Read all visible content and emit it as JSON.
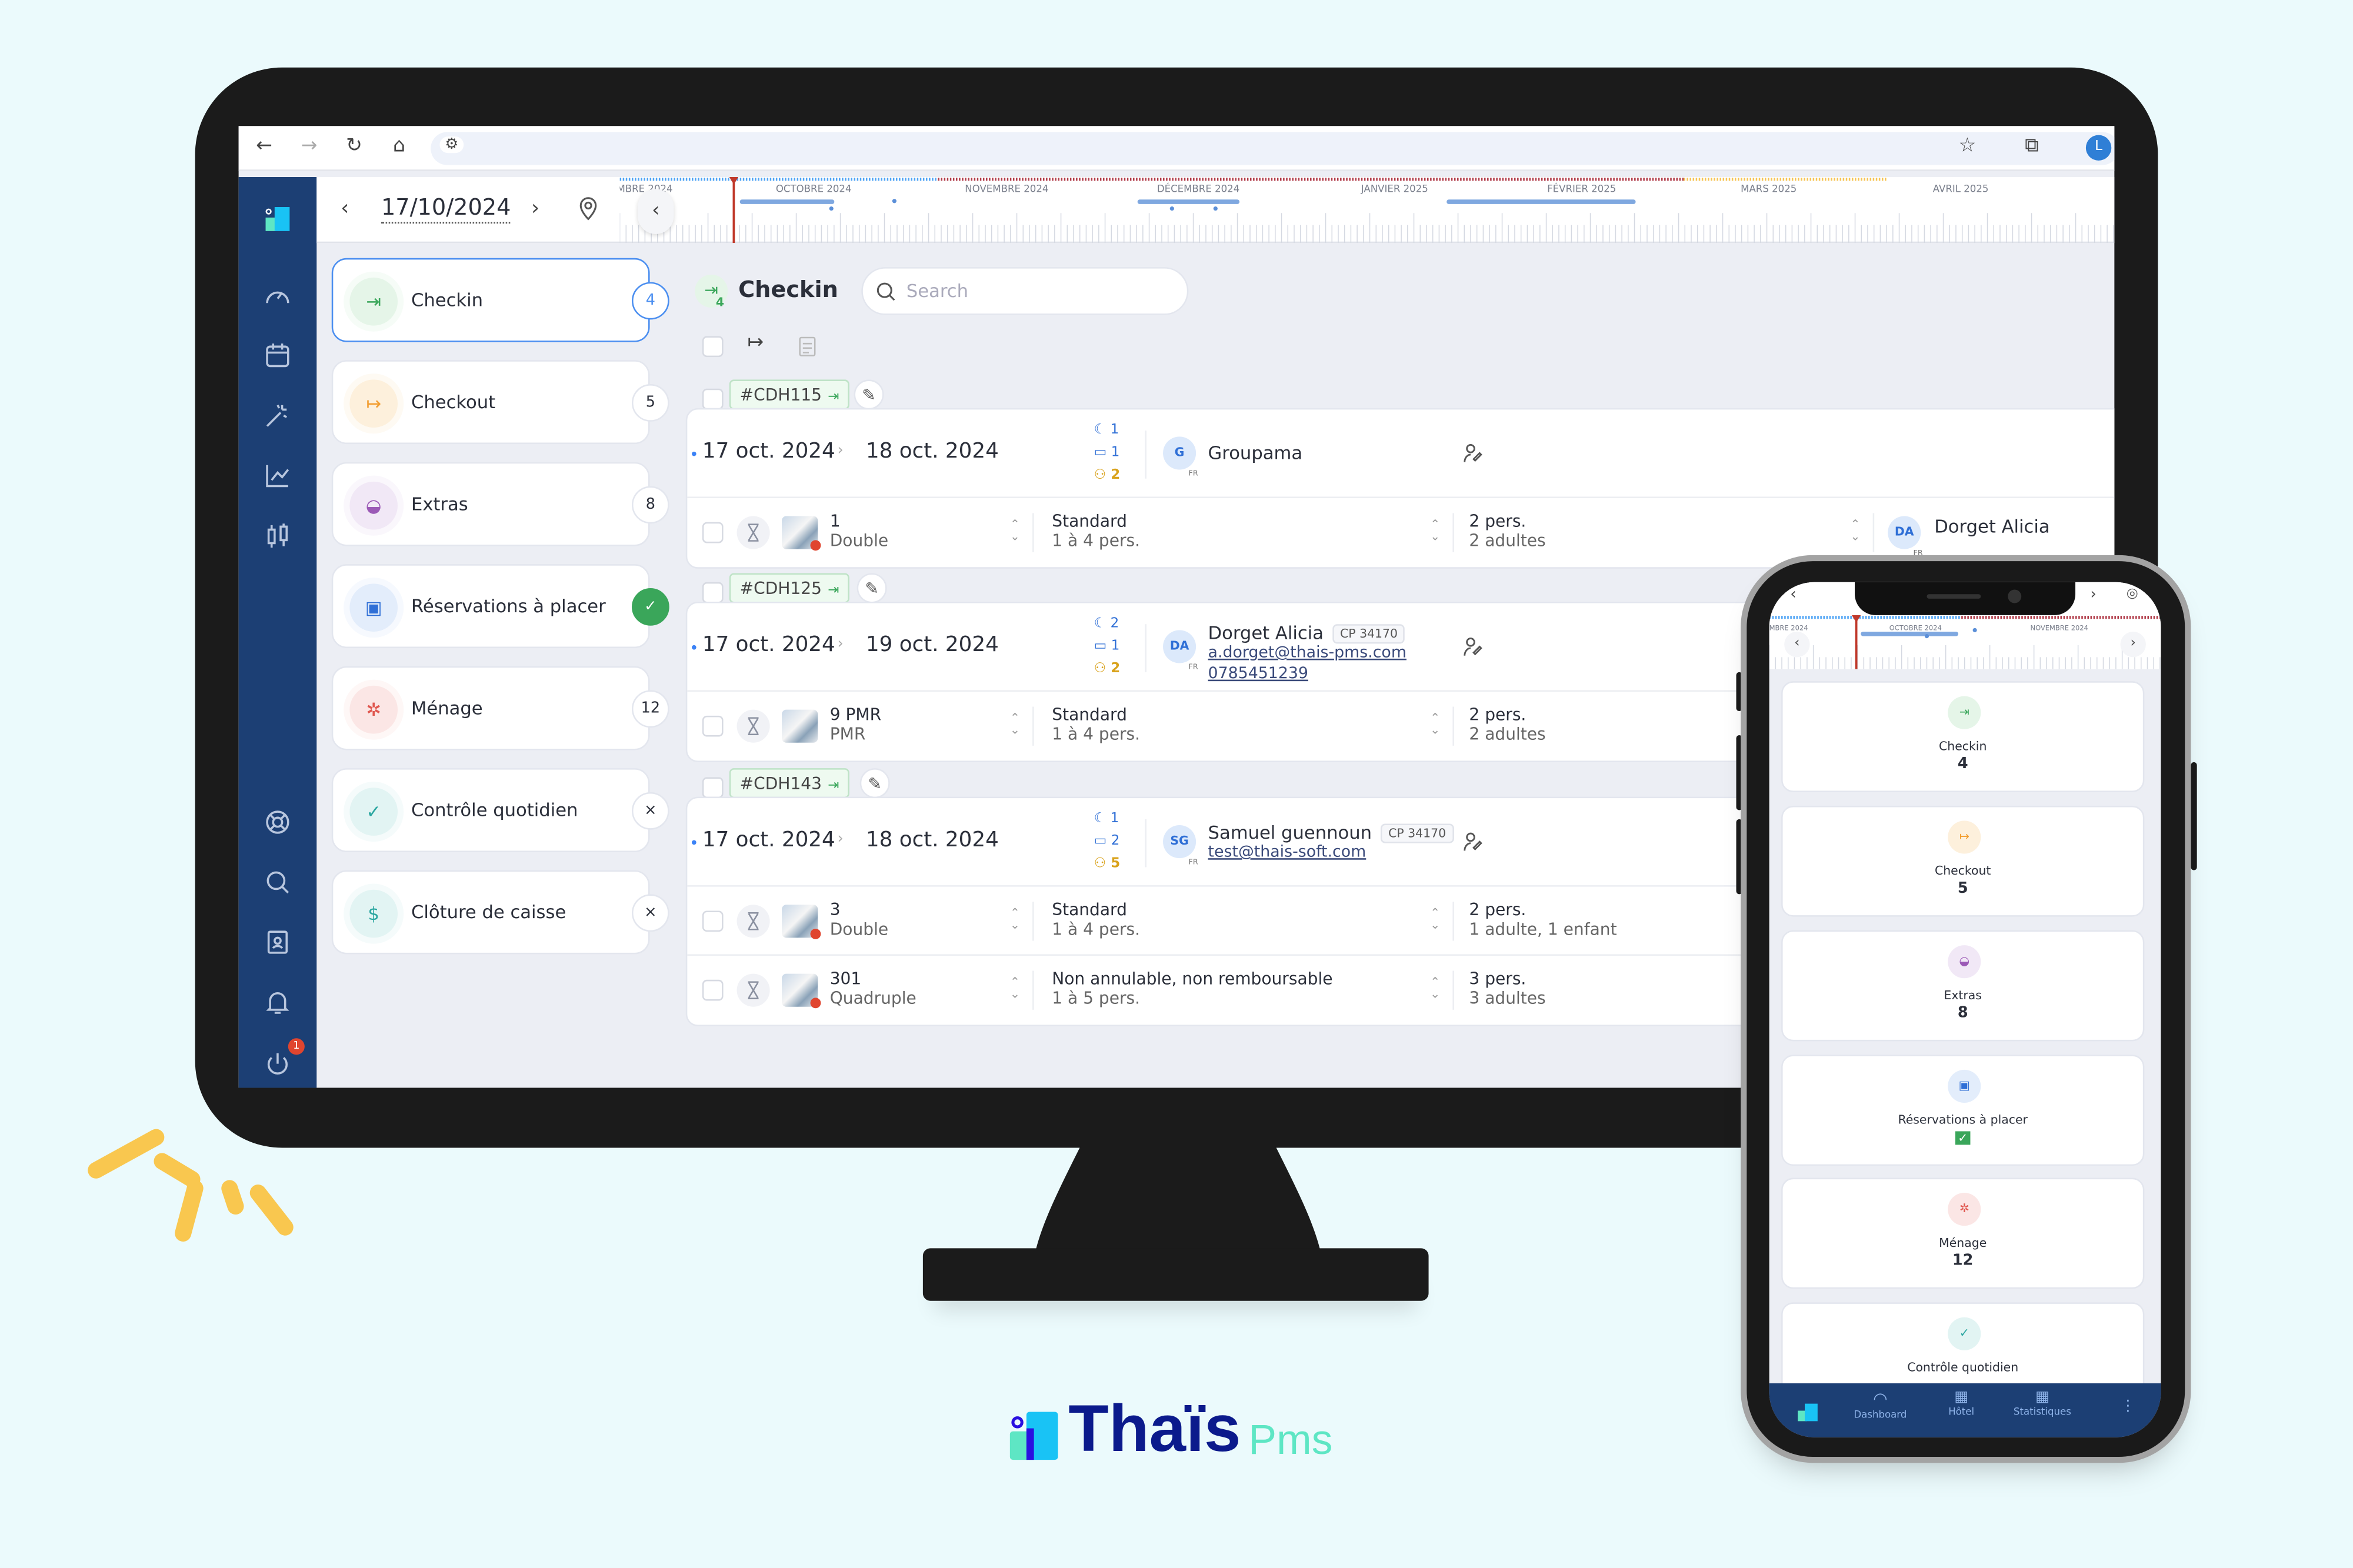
{
  "browser": {
    "icons": [
      "back-arrow-icon",
      "forward-arrow-icon",
      "reload-icon",
      "home-icon",
      "site-settings-icon",
      "star-icon",
      "extensions-icon"
    ],
    "profile_initial": "L"
  },
  "sidebar": {
    "notification_count": "1"
  },
  "header": {
    "date": "17/10/2024",
    "timeline_months": [
      "MBRE 2024",
      "OCTOBRE 2024",
      "NOVEMBRE 2024",
      "DÉCEMBRE 2024",
      "JANVIER 2025",
      "FÉVRIER 2025",
      "MARS 2025",
      "AVRIL 2025"
    ]
  },
  "left_panel": [
    {
      "label": "Checkin",
      "badge": "4",
      "icon": "checkin-arrow-icon",
      "color": "#3aa65a",
      "bg": "#e5f5e8"
    },
    {
      "label": "Checkout",
      "badge": "5",
      "icon": "checkout-arrow-icon",
      "color": "#f29d2f",
      "bg": "#fdf0dc"
    },
    {
      "label": "Extras",
      "badge": "8",
      "icon": "basket-icon",
      "color": "#9b59b6",
      "bg": "#f1e8f6"
    },
    {
      "label": "Réservations à placer",
      "badge": "✓",
      "icon": "calendar-plus-icon",
      "color": "#2f6fd6",
      "bg": "#e3edfb"
    },
    {
      "label": "Ménage",
      "badge": "12",
      "icon": "magic-wand-icon",
      "color": "#e0574f",
      "bg": "#fbe6e5"
    },
    {
      "label": "Contrôle quotidien",
      "badge": "×",
      "icon": "check-icon",
      "color": "#2aa6a0",
      "bg": "#e2f4f3"
    },
    {
      "label": "Clôture de caisse",
      "badge": "×",
      "icon": "cash-register-icon",
      "color": "#2aa6a0",
      "bg": "#e2f4f3"
    }
  ],
  "main": {
    "title": "Checkin",
    "title_badge": "4",
    "search_placeholder": "Search"
  },
  "reservations": [
    {
      "code": "#CDH115",
      "arrival": "17 oct. 2024",
      "departure": "18 oct. 2024",
      "nights": "1",
      "rooms_count": "1",
      "guests": "2",
      "initials": "G",
      "country": "FR",
      "name": "Groupama",
      "rooms": [
        {
          "number": "1",
          "type": "Double",
          "rate": "Standard",
          "capacity": "1 à 4 pers.",
          "pers": "2 pers.",
          "composition": "2 adultes",
          "guest_initials": "DA",
          "guest_country": "FR",
          "guest_name": "Dorget Alicia"
        }
      ]
    },
    {
      "code": "#CDH125",
      "arrival": "17 oct. 2024",
      "departure": "19 oct. 2024",
      "nights": "2",
      "rooms_count": "1",
      "guests": "2",
      "initials": "DA",
      "country": "FR",
      "name": "Dorget Alicia",
      "cp": "CP 34170",
      "email": "a.dorget@thais-pms.com",
      "phone": "0785451239",
      "rooms": [
        {
          "number": "9 PMR",
          "type": "PMR",
          "rate": "Standard",
          "capacity": "1 à 4 pers.",
          "pers": "2 pers.",
          "composition": "2 adultes"
        }
      ]
    },
    {
      "code": "#CDH143",
      "arrival": "17 oct. 2024",
      "departure": "18 oct. 2024",
      "nights": "1",
      "rooms_count": "2",
      "guests": "5",
      "initials": "SG",
      "country": "FR",
      "name": "Samuel guennoun",
      "cp": "CP 34170",
      "email": "test@thais-soft.com",
      "rooms": [
        {
          "number": "3",
          "type": "Double",
          "rate": "Standard",
          "capacity": "1 à 4 pers.",
          "pers": "2 pers.",
          "composition": "1 adulte, 1 enfant"
        },
        {
          "number": "301",
          "type": "Quadruple",
          "rate": "Non annulable, non remboursable",
          "capacity": "1 à 5 pers.",
          "pers": "3 pers.",
          "composition": "3 adultes"
        }
      ]
    }
  ],
  "phone": {
    "timeline_months": [
      "MBRE 2024",
      "OCTOBRE 2024",
      "NOVEMBRE 2024"
    ],
    "cards": [
      {
        "label": "Checkin",
        "count": "4"
      },
      {
        "label": "Checkout",
        "count": "5"
      },
      {
        "label": "Extras",
        "count": "8"
      },
      {
        "label": "Réservations à placer",
        "count": "✓"
      },
      {
        "label": "Ménage",
        "count": "12"
      },
      {
        "label": "Contrôle quotidien",
        "count": ""
      }
    ],
    "nav": [
      "Dashboard",
      "Hôtel",
      "Statistiques"
    ]
  },
  "logo": {
    "brand": "Thaïs",
    "suffix": "Pms"
  },
  "colors": {
    "sidebar": "#1c3f74",
    "accent": "#4a8ef0",
    "checkin": "#3aa65a",
    "background": "#ebfafc",
    "logo_navy": "#0b1a8c",
    "logo_mint": "#5ee6c4"
  }
}
